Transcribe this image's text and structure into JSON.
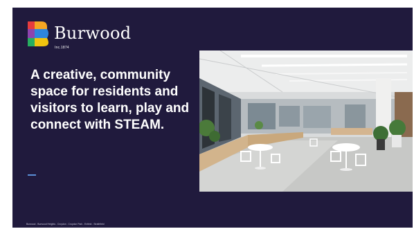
{
  "brand": {
    "name": "Burwood",
    "established": "Inc.1874",
    "colors": [
      "#e73c3e",
      "#f5a623",
      "#8e44ad",
      "#2e86de",
      "#27ae60",
      "#f1c40f"
    ]
  },
  "slide": {
    "background": "#201a3d",
    "headline": "A creative, community space for residents and visitors to learn, play and connect with STEAM.",
    "footer": "Burwood . Burwood Heights . Croydon . Croydon Park . Enfield . Strathfield"
  },
  "photo": {
    "subject": "bright open-plan library interior with white tables, chairs and plants"
  }
}
